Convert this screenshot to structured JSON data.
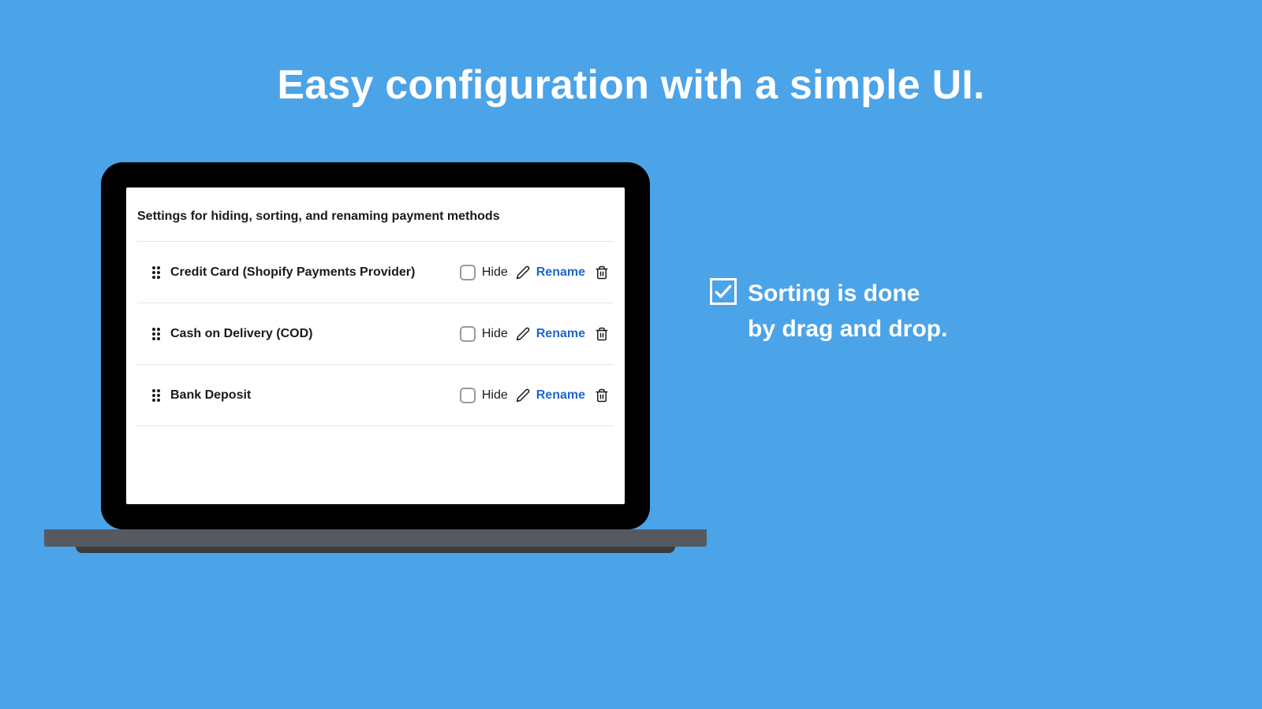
{
  "headline": "Easy configuration with a simple UI.",
  "panel": {
    "title": "Settings for hiding, sorting, and renaming payment methods",
    "hide_label": "Hide",
    "rename_label": "Rename",
    "methods": [
      {
        "name": "Credit Card (Shopify Payments Provider)"
      },
      {
        "name": "Cash on Delivery (COD)"
      },
      {
        "name": "Bank Deposit"
      }
    ]
  },
  "callout": {
    "line1": "Sorting is done",
    "line2": "by drag and drop."
  }
}
